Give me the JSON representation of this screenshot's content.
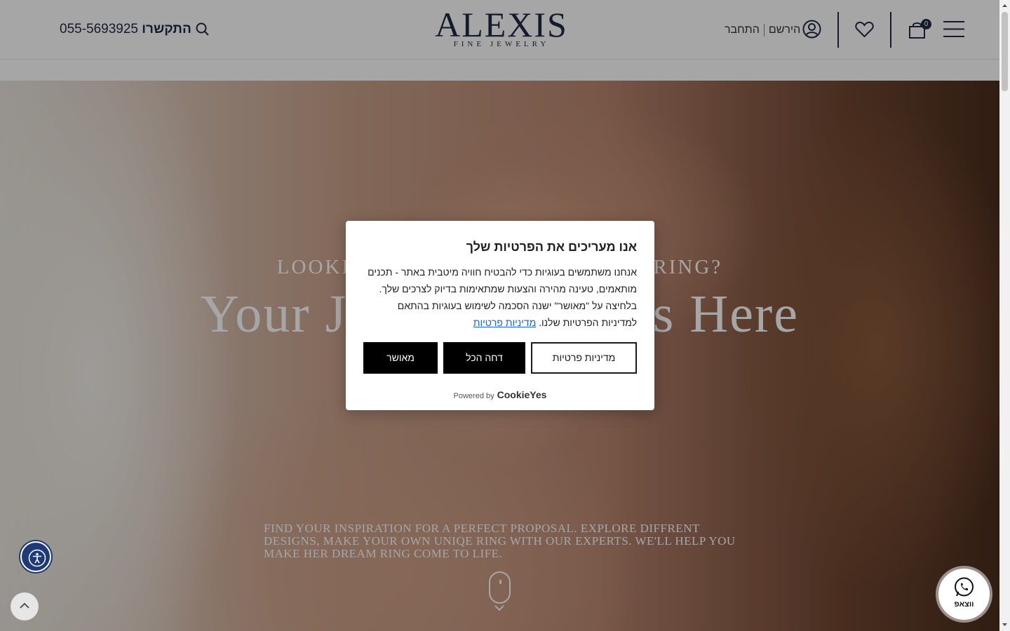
{
  "header": {
    "logo_main": "ALEXIS",
    "logo_sub": "FINE JEWELRY",
    "contact_label": "התקשרו",
    "contact_phone": "055-5693925",
    "register_label": "הירשם",
    "login_label": "התחבר",
    "cart_count": "0"
  },
  "hero": {
    "subtitle": "LOOKING FOR AN ENGAGEMENT RING?",
    "title": "Your Journey Begins Here",
    "description": "Find your inspiration for a perfect proposal. Explore diffrent designs, make your own uniqe ring with our experts. We'll help you make her dream ring come to life."
  },
  "cookie_modal": {
    "title": "אנו מעריכים את הפרטיות שלך",
    "body": "אנחנו משתמשים בעוגיות כדי להבטיח חוויה מיטבית באתר - תכנים מותאמים, טעינה מהירה והצעות שמתאימות בדיוק לצרכים שלך. בלחיצה על \"מאושר\" ישנה הסכמה לשימוש בעוגיות בהתאם למדיניות הפרטיות שלנו.",
    "policy_link": "מדיניות פרטיות",
    "policy_button": "מדיניות פרטיות",
    "reject_button": "דחה הכל",
    "accept_button": "מאושר",
    "powered_by": "Powered by",
    "powered_brand": "CookieYes"
  },
  "floating": {
    "whatsapp_label": "ווצאפ"
  },
  "colors": {
    "brand_navy": "#1f2a44",
    "link_blue": "#1863dc",
    "accessibility_blue": "#1f3a7a"
  }
}
